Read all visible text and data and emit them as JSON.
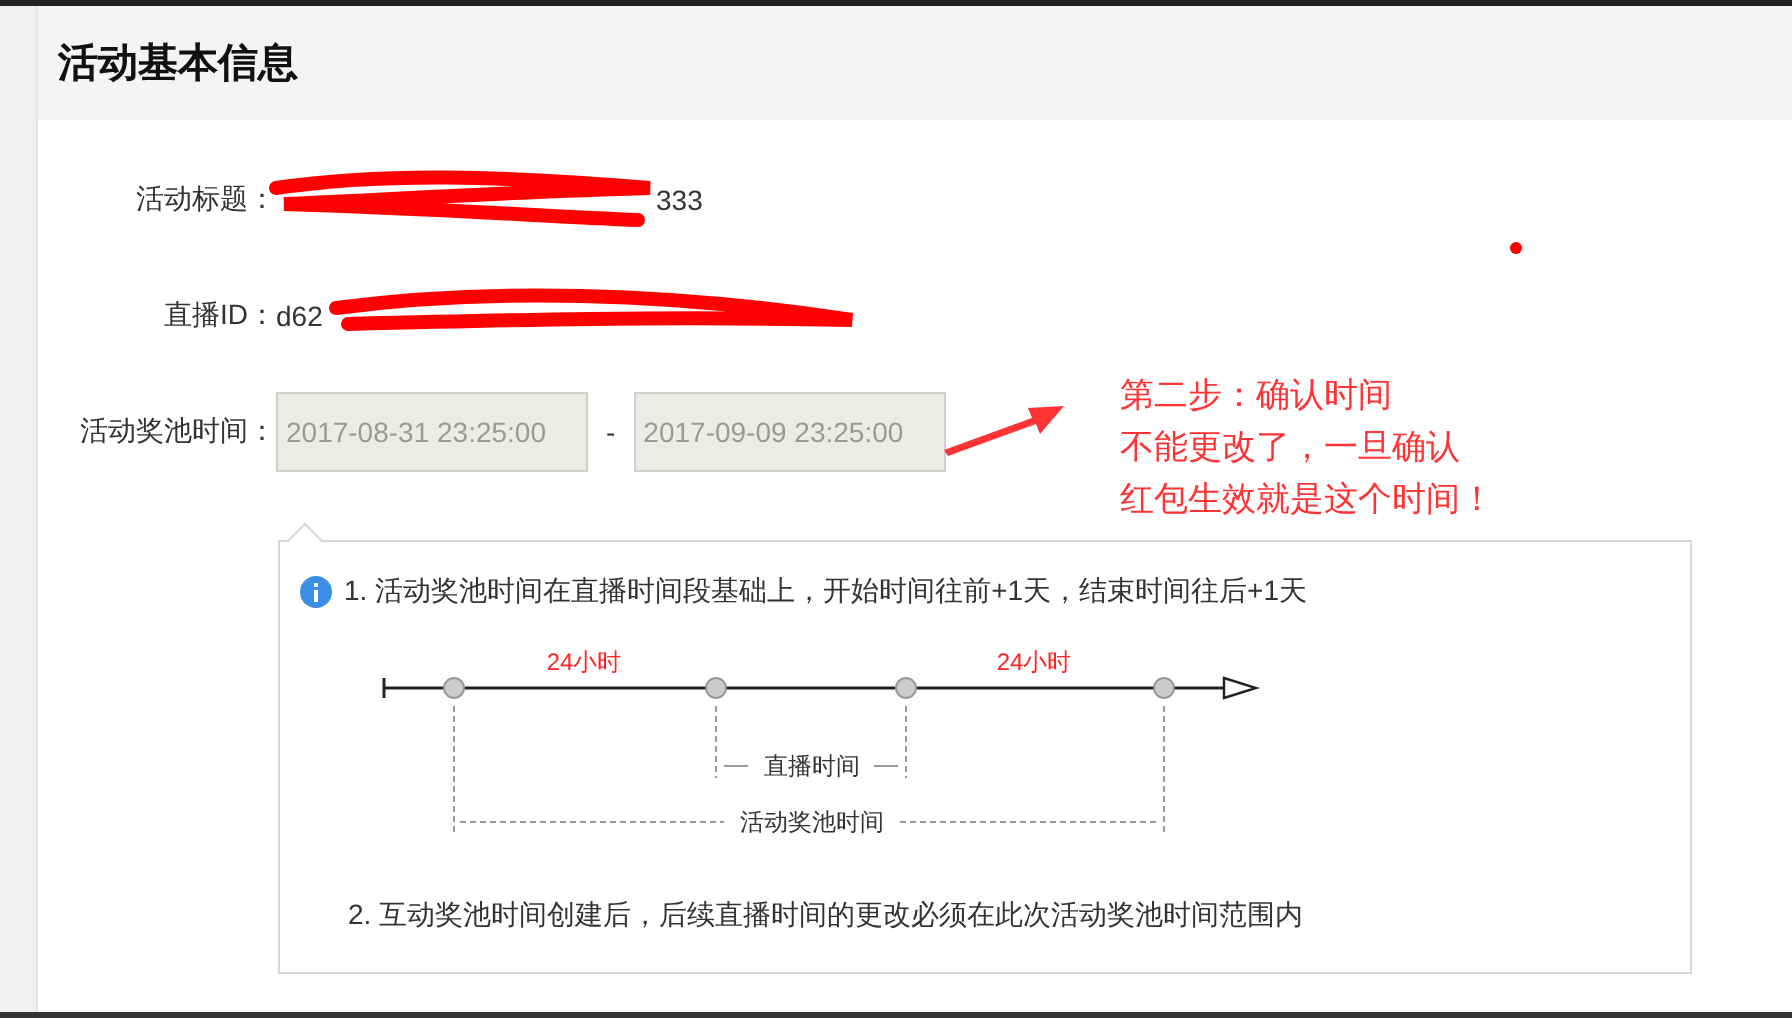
{
  "header": {
    "title": "活动基本信息"
  },
  "fields": [
    {
      "kind": "text",
      "label": "活动标题：",
      "value_fragment": "333"
    },
    {
      "kind": "text",
      "label": "直播ID：",
      "value_fragment": "d62"
    },
    {
      "kind": "range",
      "label": "活动奖池时间：",
      "start": "2017-08-31 23:25:00",
      "separator": "-",
      "end": "2017-09-09 23:25:00"
    }
  ],
  "annotation": {
    "lines": [
      "第二步：确认时间",
      "不能更改了，一旦确认",
      "红包生效就是这个时间！"
    ]
  },
  "tip": {
    "items": [
      "1. 活动奖池时间在直播时间段基础上，开始时间往前+1天，结束时间往后+1天",
      "2. 互动奖池时间创建后，后续直播时间的更改必须在此次活动奖池时间范围内"
    ],
    "diagram": {
      "segment_labels": [
        "24小时",
        "24小时"
      ],
      "live_label": "直播时间",
      "pool_label": "活动奖池时间"
    }
  }
}
